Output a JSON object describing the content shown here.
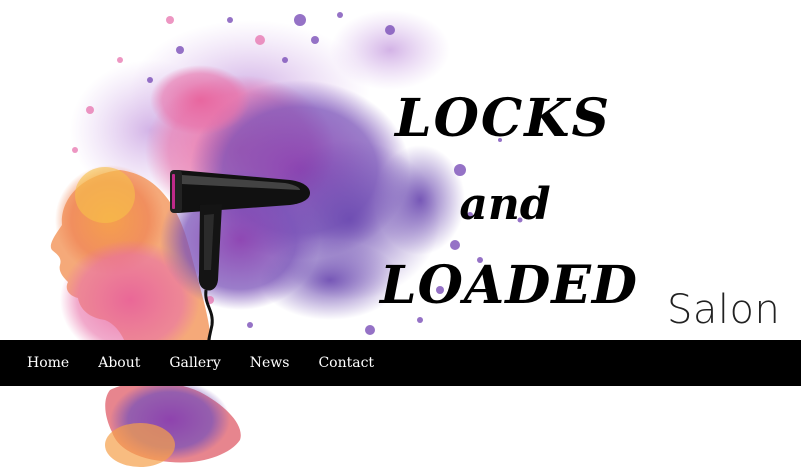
{
  "brand": {
    "title_line1": "LOCKS",
    "title_line2": "and",
    "title_line3": "LOADED",
    "subtitle": "Salon",
    "logo_icon": "hair-dryer-icon",
    "splash_colors": [
      "#f28a4c",
      "#e96aa3",
      "#9b4fb5",
      "#6a4fb0",
      "#f2b24a"
    ]
  },
  "nav": {
    "background": "#000000",
    "text_color": "#ffffff",
    "items": [
      {
        "label": "Home"
      },
      {
        "label": "About"
      },
      {
        "label": "Gallery"
      },
      {
        "label": "News"
      },
      {
        "label": "Contact"
      }
    ]
  }
}
